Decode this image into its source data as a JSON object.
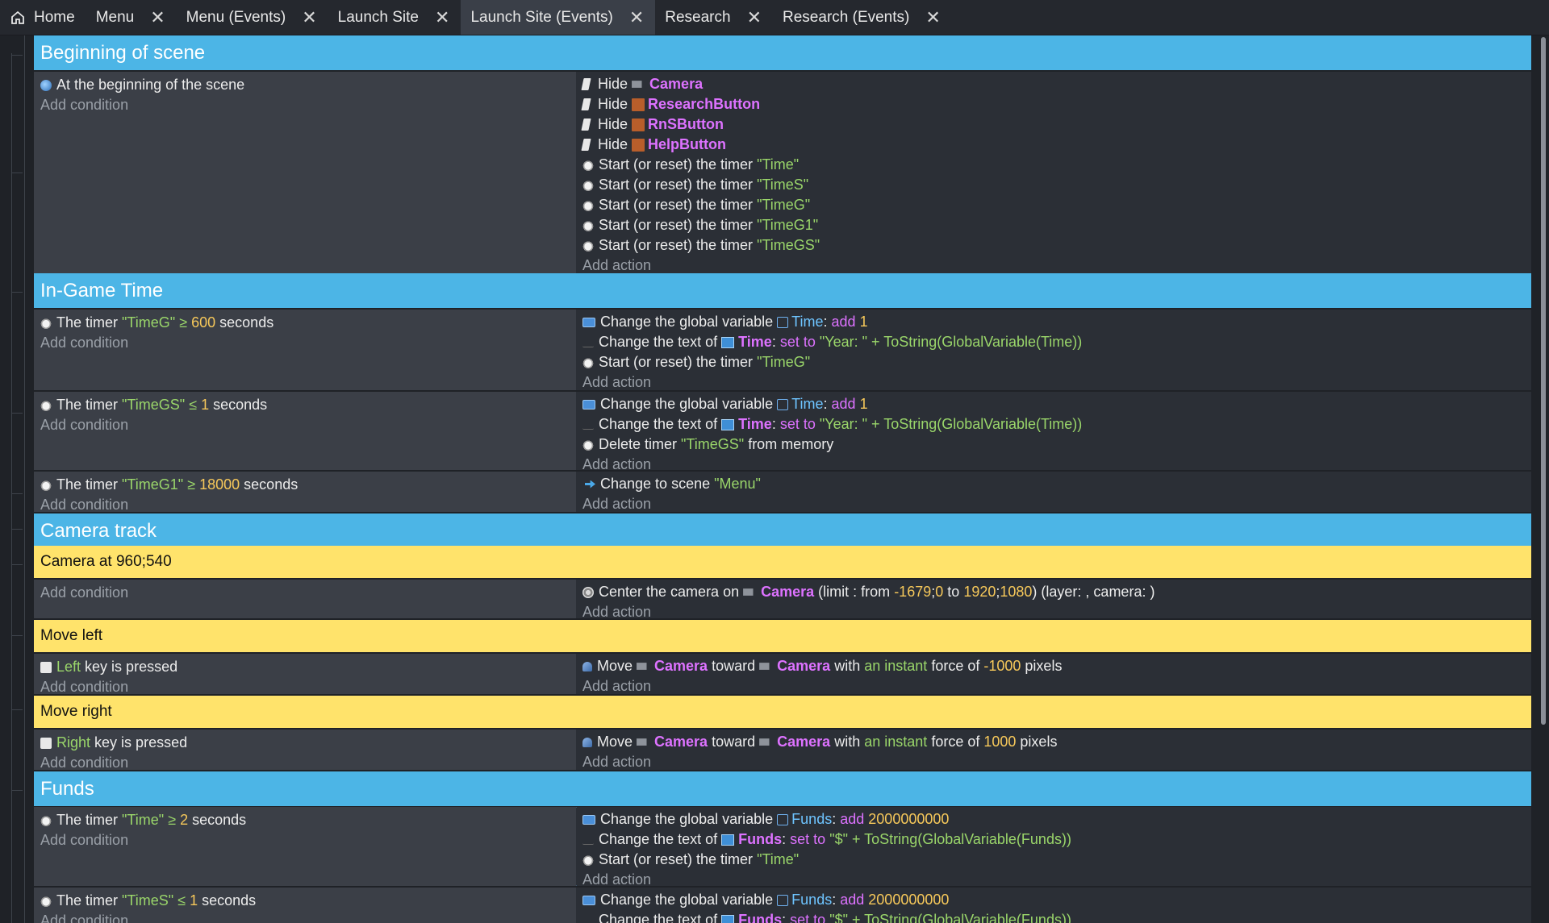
{
  "tabs": [
    {
      "label": "Home",
      "active": false,
      "closable": false
    },
    {
      "label": "Menu",
      "active": false,
      "closable": true
    },
    {
      "label": "Menu (Events)",
      "active": false,
      "closable": true
    },
    {
      "label": "Launch Site",
      "active": false,
      "closable": true
    },
    {
      "label": "Launch Site (Events)",
      "active": true,
      "closable": true
    },
    {
      "label": "Research",
      "active": false,
      "closable": true
    },
    {
      "label": "Research (Events)",
      "active": false,
      "closable": true
    }
  ],
  "close_glyph": "✕",
  "add_condition": "Add condition",
  "add_action": "Add action",
  "groups": {
    "beginning": "Beginning of scene",
    "ingame_time": "In-Game Time",
    "camera_track": "Camera track",
    "funds": "Funds"
  },
  "comments": {
    "camera_center": "Camera at 960;540",
    "move_left": "Move left",
    "move_right": "Move right"
  },
  "e1": {
    "cond": "At the beginning of the scene",
    "hide": "Hide",
    "objects": [
      "Camera",
      "ResearchButton",
      "RnSButton",
      "HelpButton"
    ],
    "timer_action": "Start (or reset) the timer",
    "timers": [
      "\"Time\"",
      "\"TimeS\"",
      "\"TimeG\"",
      "\"TimeG1\"",
      "\"TimeGS\""
    ]
  },
  "e2": {
    "cond_pre": "The timer",
    "cond_timer": "\"TimeG\"",
    "cond_op": "≥",
    "cond_val": "600",
    "cond_post": "seconds",
    "a1_pre": "Change the global variable",
    "a1_var": "Time",
    "a1_op": "add",
    "a1_val": "1",
    "a2_pre": "Change the text of",
    "a2_obj": "Time",
    "a2_op": "set to",
    "a2_val": "\"Year: \" + ToString(GlobalVariable(Time))",
    "a3_pre": "Start (or reset) the timer",
    "a3_val": "\"TimeG\""
  },
  "e3": {
    "cond_pre": "The timer",
    "cond_timer": "\"TimeGS\"",
    "cond_op": "≤",
    "cond_val": "1",
    "cond_post": "seconds",
    "a1_pre": "Change the global variable",
    "a1_var": "Time",
    "a1_op": "add",
    "a1_val": "1",
    "a2_pre": "Change the text of",
    "a2_obj": "Time",
    "a2_op": "set to",
    "a2_val": "\"Year: \" + ToString(GlobalVariable(Time))",
    "a3_pre": "Delete timer",
    "a3_val": "\"TimeGS\"",
    "a3_post": "from memory"
  },
  "e4": {
    "cond_pre": "The timer",
    "cond_timer": "\"TimeG1\"",
    "cond_op": "≥",
    "cond_val": "18000",
    "cond_post": "seconds",
    "a1_pre": "Change to scene",
    "a1_val": "\"Menu\""
  },
  "e5": {
    "a1_pre": "Center the camera on",
    "a1_obj": "Camera",
    "a1_limit": "(limit : from",
    "a1_x1": "-1679",
    "a1_sep1": ";",
    "a1_y1": "0",
    "a1_to": "to",
    "a1_x2": "1920",
    "a1_sep2": ";",
    "a1_y2": "1080",
    "a1_post": ") (layer: , camera: )"
  },
  "e6": {
    "cond_key": "Left",
    "cond_post": "key is pressed",
    "a1_pre": "Move",
    "a1_obj": "Camera",
    "a1_toward": "toward",
    "a1_target": "Camera",
    "a1_with": "with",
    "a1_force": "an instant",
    "a1_forceof": "force of",
    "a1_val": "-1000",
    "a1_unit": "pixels"
  },
  "e7": {
    "cond_key": "Right",
    "cond_post": "key is pressed",
    "a1_pre": "Move",
    "a1_obj": "Camera",
    "a1_toward": "toward",
    "a1_target": "Camera",
    "a1_with": "with",
    "a1_force": "an instant",
    "a1_forceof": "force of",
    "a1_val": "1000",
    "a1_unit": "pixels"
  },
  "e8": {
    "cond_pre": "The timer",
    "cond_timer": "\"Time\"",
    "cond_op": "≥",
    "cond_val": "2",
    "cond_post": "seconds",
    "a1_pre": "Change the global variable",
    "a1_var": "Funds",
    "a1_op": "add",
    "a1_val": "2000000000",
    "a2_pre": "Change the text of",
    "a2_obj": "Funds",
    "a2_op": "set to",
    "a2_val": "\"$\" + ToString(GlobalVariable(Funds))",
    "a3_pre": "Start (or reset) the timer",
    "a3_val": "\"Time\""
  },
  "e9": {
    "cond_pre": "The timer",
    "cond_timer": "\"TimeS\"",
    "cond_op": "≤",
    "cond_val": "1",
    "cond_post": "seconds",
    "a1_pre": "Change the global variable",
    "a1_var": "Funds",
    "a1_op": "add",
    "a1_val": "2000000000",
    "a2_pre": "Change the text of",
    "a2_obj": "Funds",
    "a2_op": "set to",
    "a2_val": "\"$\" + ToString(GlobalVariable(Funds))"
  },
  "colors": {
    "group": "#4cb5e6",
    "comment": "#ffe36b",
    "object": "#dd72ff",
    "string": "#9ad66a",
    "number": "#f6c85a",
    "variable": "#6ec4ff"
  }
}
